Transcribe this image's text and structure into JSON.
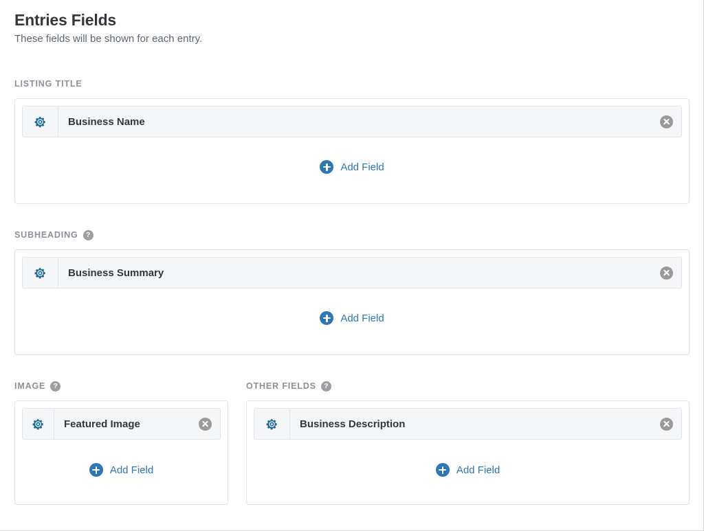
{
  "header": {
    "title": "Entries Fields",
    "subtitle": "These fields will be shown for each entry."
  },
  "icons": {
    "gear": "gear-icon",
    "delete": "delete-circle-icon",
    "add": "plus-circle-icon",
    "help": "help-circle-icon",
    "help_glyph": "?"
  },
  "colors": {
    "gear_blue": "#1b6a94",
    "link_blue": "#2e76b4",
    "panel_border": "#dde5f0",
    "row_background": "#f5f6f7",
    "icon_gray": "#9a9a9a",
    "label_gray": "#8c9199",
    "title_dark": "#32373c"
  },
  "sections": [
    {
      "label": "LISTING TITLE",
      "has_help": false,
      "fields": [
        {
          "name": "Business Name"
        }
      ],
      "add_label": "Add Field"
    },
    {
      "label": "SUBHEADING",
      "has_help": true,
      "fields": [
        {
          "name": "Business Summary"
        }
      ],
      "add_label": "Add Field"
    },
    {
      "label": "IMAGE",
      "has_help": true,
      "fields": [
        {
          "name": "Featured Image"
        }
      ],
      "add_label": "Add Field"
    },
    {
      "label": "OTHER FIELDS",
      "has_help": true,
      "fields": [
        {
          "name": "Business Description"
        }
      ],
      "add_label": "Add Field"
    }
  ]
}
